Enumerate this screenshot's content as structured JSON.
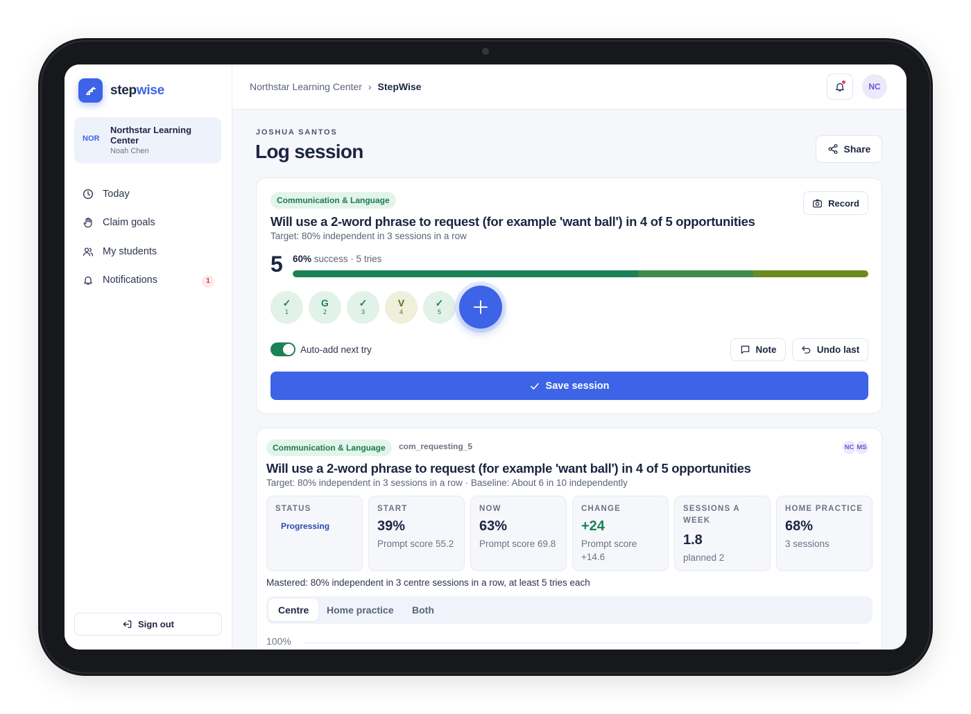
{
  "brand": {
    "name_prefix": "step",
    "name_suffix": "wise"
  },
  "org": {
    "badge": "NOR",
    "name": "Northstar Learning Center",
    "user": "Noah Chen"
  },
  "nav": [
    {
      "label": "Today",
      "icon": "clock-icon"
    },
    {
      "label": "Claim goals",
      "icon": "hand-icon"
    },
    {
      "label": "My students",
      "icon": "users-icon"
    },
    {
      "label": "Notifications",
      "icon": "bell-icon",
      "badge": "1"
    }
  ],
  "signout": "Sign out",
  "breadcrumb": {
    "parent": "Northstar Learning Center",
    "separator": "›",
    "current": "StepWise"
  },
  "topbar": {
    "avatar": "NC"
  },
  "page": {
    "student": "JOSHUA SANTOS",
    "title": "Log session",
    "share": "Share"
  },
  "session": {
    "domain": "Communication & Language",
    "record": "Record",
    "goal": "Will use a 2-word phrase to request (for example 'want ball') in 4 of 5 opportunities",
    "target": "Target: 80% independent in 3 sessions in a row",
    "count": "5",
    "rate_pct": "60%",
    "rate_rest": "success · 5 tries",
    "progress": 1.0,
    "tries": [
      {
        "symbol": "✓",
        "num": "1",
        "kind": "ok"
      },
      {
        "symbol": "G",
        "num": "2",
        "kind": "ok"
      },
      {
        "symbol": "✓",
        "num": "3",
        "kind": "ok"
      },
      {
        "symbol": "V",
        "num": "4",
        "kind": "v"
      },
      {
        "symbol": "✓",
        "num": "5",
        "kind": "ok"
      }
    ],
    "auto_add": "Auto-add next try",
    "note": "Note",
    "undo": "Undo last",
    "save": "Save session"
  },
  "goal_card": {
    "domain": "Communication & Language",
    "code": "com_requesting_5",
    "avatars": [
      "NC",
      "MS"
    ],
    "goal": "Will use a 2-word phrase to request (for example 'want ball') in 4 of 5 opportunities",
    "sub": "Target: 80% independent in 3 sessions in a row · Baseline: About 6 in 10 independently",
    "stats": {
      "status": {
        "label": "STATUS",
        "value": "Progressing"
      },
      "start": {
        "label": "START",
        "value": "39%",
        "note": "Prompt score 55.2"
      },
      "now": {
        "label": "NOW",
        "value": "63%",
        "note": "Prompt score 69.8"
      },
      "change": {
        "label": "CHANGE",
        "value": "+24",
        "note": "Prompt score +14.6"
      },
      "sessions": {
        "label": "SESSIONS A WEEK",
        "value": "1.8",
        "note": "planned 2"
      },
      "home": {
        "label": "HOME PRACTICE",
        "value": "68%",
        "note": "3 sessions"
      }
    },
    "mastered": "Mastered: 80% independent in 3 centre sessions in a row, at least 5 tries each",
    "tabs": [
      "Centre",
      "Home practice",
      "Both"
    ],
    "axis_top": "100%"
  },
  "colors": {
    "accent": "#3d63e6",
    "success": "#1b8156",
    "warn": "#6b8a1f"
  }
}
